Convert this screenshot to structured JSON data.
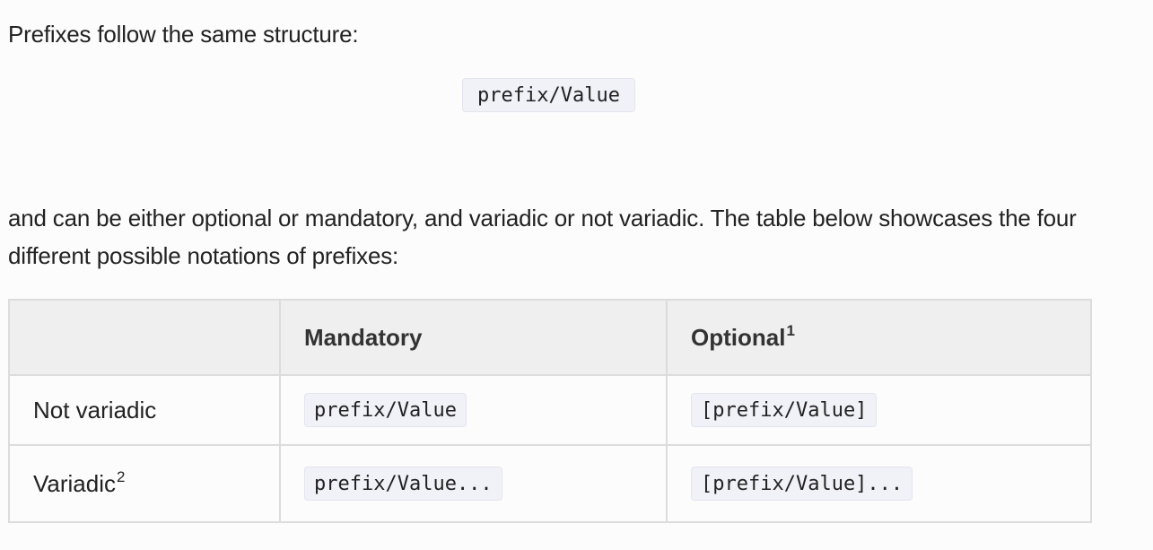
{
  "intro_text": "Prefixes follow the same structure:",
  "structure_code": "prefix/Value",
  "description_text": "and can be either optional or mandatory, and variadic or not variadic. The table below showcases the four different possible notations of prefixes:",
  "table": {
    "headers": {
      "corner": "",
      "mandatory": "Mandatory",
      "optional": "Optional",
      "optional_note": "1"
    },
    "rows": [
      {
        "label": "Not variadic",
        "label_note": "",
        "mandatory": "prefix/Value",
        "optional": "[prefix/Value]"
      },
      {
        "label": "Variadic",
        "label_note": "2",
        "mandatory": "prefix/Value...",
        "optional": "[prefix/Value]..."
      }
    ]
  }
}
